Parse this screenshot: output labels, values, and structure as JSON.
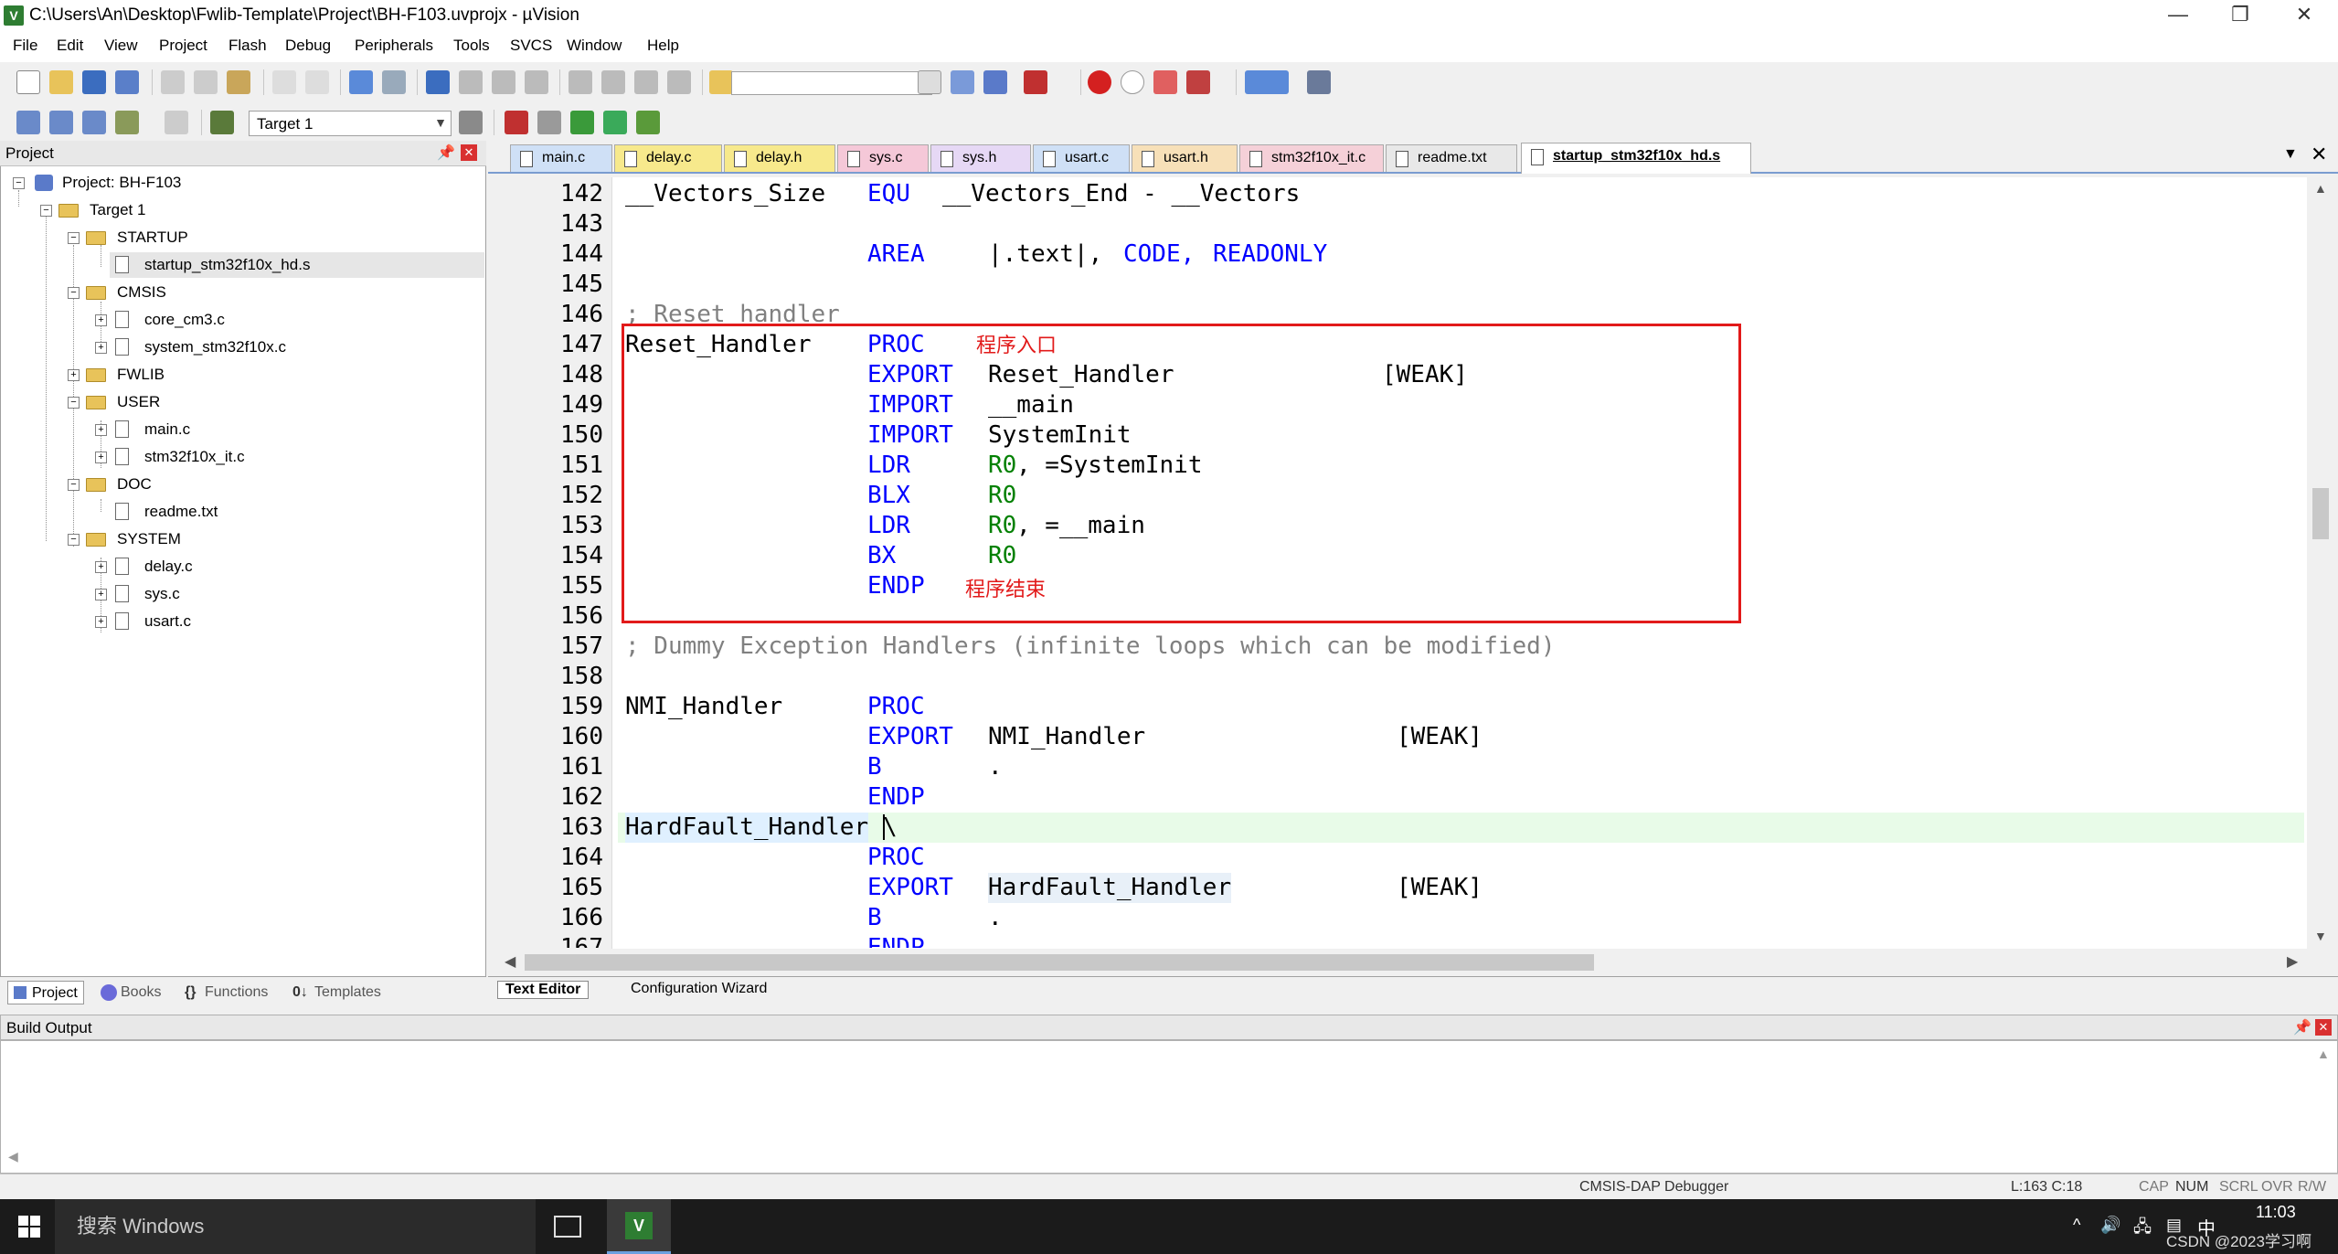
{
  "window": {
    "title": "C:\\Users\\An\\Desktop\\Fwlib-Template\\Project\\BH-F103.uvprojx - µVision",
    "minimize": "—",
    "restore": "❐",
    "close": "✕"
  },
  "menu": [
    "File",
    "Edit",
    "View",
    "Project",
    "Flash",
    "Debug",
    "Peripherals",
    "Tools",
    "SVCS",
    "Window",
    "Help"
  ],
  "toolbar2": {
    "target": "Target 1"
  },
  "project_panel": {
    "header": "Project",
    "tree": [
      {
        "label": "Project: BH-F103"
      },
      {
        "label": "Target 1"
      },
      {
        "label": "STARTUP"
      },
      {
        "label": "startup_stm32f10x_hd.s"
      },
      {
        "label": "CMSIS"
      },
      {
        "label": "core_cm3.c"
      },
      {
        "label": "system_stm32f10x.c"
      },
      {
        "label": "FWLIB"
      },
      {
        "label": "USER"
      },
      {
        "label": "main.c"
      },
      {
        "label": "stm32f10x_it.c"
      },
      {
        "label": "DOC"
      },
      {
        "label": "readme.txt"
      },
      {
        "label": "SYSTEM"
      },
      {
        "label": "delay.c"
      },
      {
        "label": "sys.c"
      },
      {
        "label": "usart.c"
      }
    ],
    "tabs": [
      "Project",
      "Books",
      "Functions",
      "Templates"
    ]
  },
  "editor_tabs": [
    "main.c",
    "delay.c",
    "delay.h",
    "sys.c",
    "sys.h",
    "usart.c",
    "usart.h",
    "stm32f10x_it.c",
    "readme.txt",
    "startup_stm32f10x_hd.s"
  ],
  "code": {
    "line_numbers": [
      "142",
      "143",
      "144",
      "145",
      "146",
      "147",
      "148",
      "149",
      "150",
      "151",
      "152",
      "153",
      "154",
      "155",
      "156",
      "157",
      "158",
      "159",
      "160",
      "161",
      "162",
      "163",
      "164",
      "165",
      "166",
      "167"
    ],
    "l142": {
      "a": "__Vectors_Size",
      "b": "EQU",
      "c": "__Vectors_End - __Vectors"
    },
    "l144": {
      "a": "AREA",
      "b": "|.text|,",
      "c": "CODE,",
      "d": "READONLY"
    },
    "l146": "; Reset handler",
    "l147": {
      "a": "Reset_Handler",
      "b": "PROC"
    },
    "l148": {
      "a": "EXPORT",
      "b": "Reset_Handler",
      "c": "[WEAK]"
    },
    "l149": {
      "a": "IMPORT",
      "b": "__main"
    },
    "l150": {
      "a": "IMPORT",
      "b": "SystemInit"
    },
    "l151": {
      "a": "LDR",
      "b": "R0",
      "c": ", =SystemInit"
    },
    "l152": {
      "a": "BLX",
      "b": "R0"
    },
    "l153": {
      "a": "LDR",
      "b": "R0",
      "c": ", =__main"
    },
    "l154": {
      "a": "BX",
      "b": "R0"
    },
    "l155": {
      "a": "ENDP"
    },
    "l157": "; Dummy Exception Handlers (infinite loops which can be modified)",
    "l159": {
      "a": "NMI_Handler",
      "b": "PROC"
    },
    "l160": {
      "a": "EXPORT",
      "b": "NMI_Handler",
      "c": "[WEAK]"
    },
    "l161": {
      "a": "B",
      "b": "."
    },
    "l162": {
      "a": "ENDP"
    },
    "l163": {
      "a": "HardFault_Handler",
      "b": "\\"
    },
    "l164": {
      "a": "PROC"
    },
    "l165": {
      "a": "EXPORT",
      "b": "HardFault_Handler",
      "c": "[WEAK]"
    },
    "l166": {
      "a": "B",
      "b": "."
    },
    "l167": {
      "a": "ENDP"
    }
  },
  "annotations": {
    "entry": "程序入口",
    "end": "程序结束"
  },
  "editor_bottom_tabs": [
    "Text Editor",
    "Configuration Wizard"
  ],
  "build_output": {
    "header": "Build Output"
  },
  "status": {
    "debugger": "CMSIS-DAP Debugger",
    "position": "L:163 C:18",
    "caps": "CAP",
    "num": "NUM",
    "scrl": "SCRL",
    "ovr": "OVR",
    "rw": "R/W"
  },
  "taskbar": {
    "search": "搜索 Windows",
    "time": "11:03",
    "ime": "中",
    "watermark": "CSDN @2023学习啊"
  }
}
